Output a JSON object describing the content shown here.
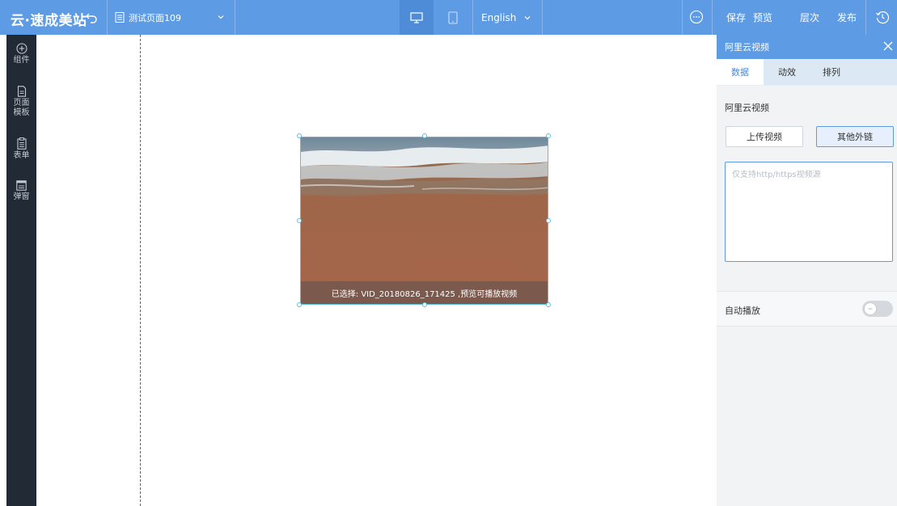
{
  "header": {
    "logo": "云·速成美站",
    "page_name": "测试页面109",
    "language": "English",
    "actions": {
      "save": "保存",
      "preview": "预览",
      "layers": "层次",
      "publish": "发布"
    }
  },
  "sidebar": {
    "items": [
      {
        "label": "组件",
        "icon": "plus-circle-icon"
      },
      {
        "label": "页面模板",
        "icon": "document-icon"
      },
      {
        "label": "表单",
        "icon": "clipboard-icon"
      },
      {
        "label": "弹窗",
        "icon": "window-icon"
      }
    ]
  },
  "canvas": {
    "video_caption": "已选择: VID_20180826_171425 ,预览可播放视频"
  },
  "panel": {
    "title": "阿里云视频",
    "tabs": [
      {
        "label": "数据",
        "active": true
      },
      {
        "label": "动效",
        "active": false
      },
      {
        "label": "排列",
        "active": false
      }
    ],
    "section_title": "阿里云视频",
    "upload_button": "上传视频",
    "external_link_button": "其他外链",
    "url_placeholder": "仅支持http/https视频源",
    "url_value": "",
    "autoplay_label": "自动播放",
    "autoplay_on": false
  },
  "colors": {
    "topbar": "#5e9be5",
    "sidebar": "#222a36",
    "accent": "#4a8ad8",
    "selection": "#5bc0de"
  }
}
